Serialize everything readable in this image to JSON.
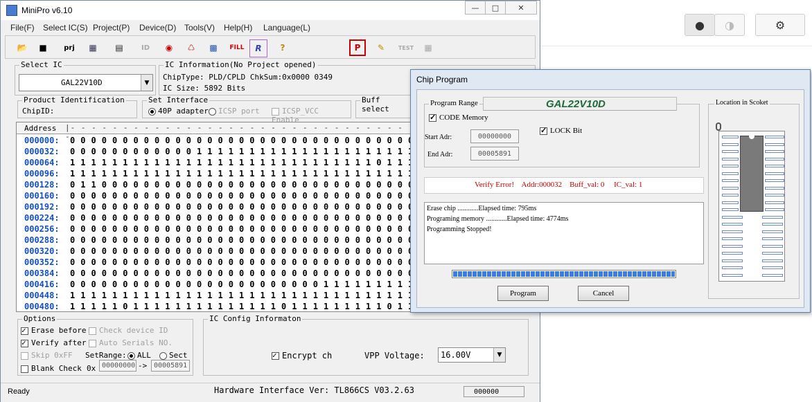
{
  "window": {
    "title": "MiniPro v6.10",
    "min": "—",
    "max": "□",
    "close": "✕"
  },
  "menu": [
    "File(F)",
    "Select IC(S)",
    "Project(P)",
    "Device(D)",
    "Tools(V)",
    "Help(H)",
    "Language(L)"
  ],
  "toolbar": {
    "icons": [
      "open-icon",
      "save-icon",
      "project-icon",
      "save-project-icon",
      "buffer-icon",
      "read-id-icon",
      "fuse-icon",
      "checksum-icon",
      "edit-icon",
      "fill-icon",
      "read-icon",
      "help-icon",
      "program-icon",
      "edit-config-icon",
      "test-icon",
      "chip-icon"
    ],
    "prj": "prj",
    "fill": "FILL",
    "r": "R",
    "help": "?",
    "p": "P",
    "test": "TEST",
    "id": "ID"
  },
  "select_ic": {
    "label": "Select IC",
    "value": "GAL22V10D"
  },
  "ic_info": {
    "label": "IC Information(No Project opened)",
    "chiptype": "ChipType:  PLD/CPLD   ChkSum:0x0000 0349",
    "size": "IC Size:   5892 Bits"
  },
  "product_id": {
    "label": "Product Identification",
    "chip_id": "ChipID:"
  },
  "interface": {
    "label": "Set Interface",
    "opt1": "40P adapter",
    "opt2": "ICSP port",
    "opt3": "ICSP_VCC Enable"
  },
  "buff_select": {
    "label": "Buff select"
  },
  "grid": {
    "address_header": "Address",
    "rows": [
      {
        "addr": "000000:",
        "bits": "0 0 0 0 0 0 0 0 0 0 0 0 0 0 0 0 0 0 0 0 0 0 0 0 0 0 0 0 0 0 0 0 0"
      },
      {
        "addr": "000032:",
        "bits": "0 0 0 0 0 0 0 0 0 0 0 0 1 1 1 1 1 1 1 1 1 1 1 1 1 1 1 1 1 1 1 1 1"
      },
      {
        "addr": "000064:",
        "bits": "1 1 1 1 1 1 1 1 1 1 1 1 1 1 1 1 1 1 1 1 1 1 1 1 1 1 1 1 1 0 1 1 1"
      },
      {
        "addr": "000096:",
        "bits": "1 1 1 1 1 1 1 1 1 1 1 1 1 1 1 1 1 1 1 1 1 1 1 1 1 1 1 1 1 1 1 1 1"
      },
      {
        "addr": "000128:",
        "bits": "0 1 1 0 0 0 0 0 0 0 0 0 0 0 0 0 0 0 0 0 0 0 0 0 0 0 0 0 0 0 0 0 0"
      },
      {
        "addr": "000160:",
        "bits": "0 0 0 0 0 0 0 0 0 0 0 0 0 0 0 0 0 0 0 0 0 0 0 0 0 0 0 0 0 0 0 0 0"
      },
      {
        "addr": "000192:",
        "bits": "0 0 0 0 0 0 0 0 0 0 0 0 0 0 0 0 0 0 0 0 0 0 0 0 0 0 0 0 0 0 0 0 0"
      },
      {
        "addr": "000224:",
        "bits": "0 0 0 0 0 0 0 0 0 0 0 0 0 0 0 0 0 0 0 0 0 0 0 0 0 0 0 0 0 0 0 0 0"
      },
      {
        "addr": "000256:",
        "bits": "0 0 0 0 0 0 0 0 0 0 0 0 0 0 0 0 0 0 0 0 0 0 0 0 0 0 0 0 0 0 0 0 0"
      },
      {
        "addr": "000288:",
        "bits": "0 0 0 0 0 0 0 0 0 0 0 0 0 0 0 0 0 0 0 0 0 0 0 0 0 0 0 0 0 0 0 0 0"
      },
      {
        "addr": "000320:",
        "bits": "0 0 0 0 0 0 0 0 0 0 0 0 0 0 0 0 0 0 0 0 0 0 0 0 0 0 0 0 0 0 0 0 0"
      },
      {
        "addr": "000352:",
        "bits": "0 0 0 0 0 0 0 0 0 0 0 0 0 0 0 0 0 0 0 0 0 0 0 0 0 0 0 0 0 0 0 0 0"
      },
      {
        "addr": "000384:",
        "bits": "0 0 0 0 0 0 0 0 0 0 0 0 0 0 0 0 0 0 0 0 0 0 0 0 0 0 0 0 0 0 0 0 0"
      },
      {
        "addr": "000416:",
        "bits": "0 0 0 0 0 0 0 0 0 0 0 0 0 0 0 0 0 0 0 0 0 0 0 0 1 1 1 1 1 1 1 1 1"
      },
      {
        "addr": "000448:",
        "bits": "1 1 1 1 1 1 1 1 1 1 1 1 1 1 1 1 1 1 1 1 1 1 1 1 1 1 1 1 1 1 1 1 1"
      },
      {
        "addr": "000480:",
        "bits": "1 1 1 1 1 0 1 1 1 1 1 1 1 1 1 1 1 1 1 1 0 1 1 1 1 1 1 1 1 1 0 1 1"
      }
    ]
  },
  "options": {
    "label": "Options",
    "erase_before": "Erase before",
    "check_device_id": "Check device ID",
    "verify_after": "Verify after",
    "auto_serials": "Auto Serials NO.",
    "skip_0xff": "Skip 0xFF",
    "setrange": "SetRange:",
    "all": "ALL",
    "sect": "Sect",
    "blank_check": "Blank Check",
    "ox": "0x",
    "range_start": "00000000",
    "arrow": "->",
    "range_end": "00005891"
  },
  "ic_config": {
    "label": "IC Config Informaton",
    "encrypt": "Encrypt ch",
    "vpp_label": "VPP Voltage:",
    "vpp_value": "16.00V"
  },
  "status": {
    "ready": "Ready",
    "hw": "Hardware Interface Ver: TL866CS V03.2.63",
    "counter": "000000"
  },
  "dialog": {
    "title": "Chip Program",
    "program_range": "Program Range",
    "chip": "GAL22V10D",
    "code_memory": "CODE Memory",
    "lock_bit": "LOCK Bit",
    "start_label": "Start Adr:",
    "start_value": "00000000",
    "end_label": "End Adr:",
    "end_value": "00005891",
    "error": "Verify Error!    Addr:000032    Buff_val: 0     IC_val: 1",
    "log": [
      "Erase chip ............Elapsed time: 795ms",
      "Programing memory ............Elapsed time: 4774ms",
      "Programming Stopped!"
    ],
    "progress": 1.0,
    "program_btn": "Program",
    "cancel_btn": "Cancel",
    "socket_label": "Location in Scoket"
  },
  "colors": {
    "address": "#1150c8",
    "error": "#c00000",
    "progress": "#3b7de0",
    "chip_title": "#1e6a3a"
  }
}
